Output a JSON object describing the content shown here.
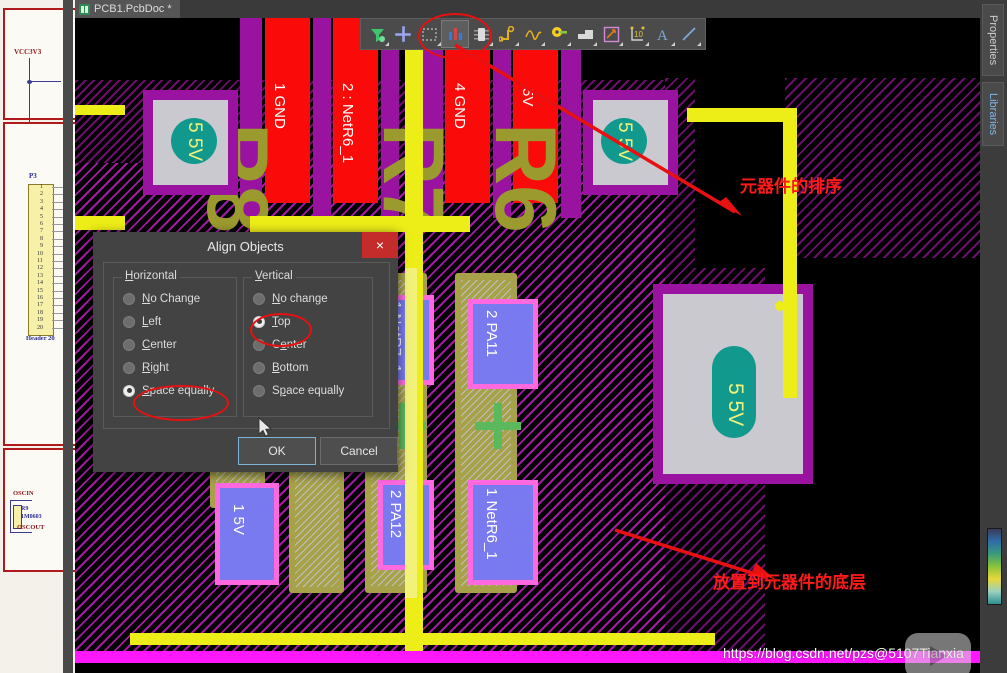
{
  "app": {
    "document_tab": "PCB1.PcbDoc *",
    "tab_icon": "pcb-document-icon"
  },
  "toolbar": {
    "name": "wiring-toolbar",
    "buttons": [
      {
        "icon": "net-filter-icon",
        "label": "Net Filter"
      },
      {
        "icon": "via-cross-icon",
        "label": "Place Via"
      },
      {
        "icon": "fill-region-icon",
        "label": "Place Fill"
      },
      {
        "icon": "component-bars-icon",
        "label": "Place Component",
        "selected": true
      },
      {
        "icon": "ic-chip-icon",
        "label": "Place Device"
      },
      {
        "icon": "route-track-icon",
        "label": "Interactive Routing"
      },
      {
        "icon": "differential-pair-icon",
        "label": "Differential Pair Routing"
      },
      {
        "icon": "pad-icon",
        "label": "Place Pad"
      },
      {
        "icon": "polygon-pour-icon",
        "label": "Place Polygon Pour"
      },
      {
        "icon": "dimension-icon",
        "label": "Place Dimension"
      },
      {
        "icon": "coordinate-icon",
        "label": "Place Coordinate"
      },
      {
        "icon": "text-string-icon",
        "label": "Place String"
      },
      {
        "icon": "line-icon",
        "label": "Place Line"
      }
    ]
  },
  "dialog": {
    "title": "Align Objects",
    "close_label": "×",
    "horizontal": {
      "caption": "Horizontal",
      "caption_accel": "H",
      "options": [
        {
          "label": "No Change",
          "accel": "N",
          "selected": false
        },
        {
          "label": "Left",
          "accel": "L",
          "selected": false
        },
        {
          "label": "Center",
          "accel": "C",
          "selected": false
        },
        {
          "label": "Right",
          "accel": "R",
          "selected": false
        },
        {
          "label": "Space equally",
          "accel": "S",
          "selected": true
        }
      ]
    },
    "vertical": {
      "caption": "Vertical",
      "caption_accel": "V",
      "options": [
        {
          "label": "No change",
          "accel": "N",
          "selected": false
        },
        {
          "label": "Top",
          "accel": "T",
          "selected": true
        },
        {
          "label": "Center",
          "accel": "e",
          "selected": false
        },
        {
          "label": "Bottom",
          "accel": "B",
          "selected": false
        },
        {
          "label": "Space equally",
          "accel": "p",
          "selected": false
        }
      ]
    },
    "ok_label": "OK",
    "cancel_label": "Cancel"
  },
  "annotations": [
    {
      "text": "元器件的排序",
      "color": "#ff1a1a"
    },
    {
      "text": "放置到元器件的底层",
      "color": "#ff1a1a"
    }
  ],
  "right_dock": {
    "tabs": [
      {
        "label": "Properties",
        "accent": "#cfcfcf"
      },
      {
        "label": "Libraries",
        "accent": "#7fb8e8"
      }
    ]
  },
  "schematic": {
    "labels": [
      {
        "text": "VCC3V3",
        "color": "#8b1a1a"
      },
      {
        "text": "P3",
        "color": "#2b2b8f"
      },
      {
        "text": "Header 20",
        "color": "#2b2b8f"
      },
      {
        "text": "OSCIN",
        "color": "#8b1a1a"
      },
      {
        "text": "R9",
        "color": "#2b2b8f"
      },
      {
        "text": "1M0603",
        "color": "#2b2b8f"
      },
      {
        "text": "OSCOUT",
        "color": "#8b1a1a"
      }
    ],
    "header_pins": [
      "1",
      "2",
      "3",
      "4",
      "5",
      "6",
      "7",
      "8",
      "9",
      "10",
      "11",
      "12",
      "13",
      "14",
      "15",
      "16",
      "17",
      "18",
      "19",
      "20"
    ]
  },
  "pcb": {
    "pad_labels": [
      {
        "text": "1  GND",
        "color": "#ffffff"
      },
      {
        "text": "2 : NetR6_1",
        "color": "#ffffff"
      },
      {
        "text": "4  GND",
        "color": "#ffffff"
      },
      {
        "text": "5V",
        "color": "#ffffff"
      },
      {
        "text": "1 NetR7_1",
        "color": "#ffffff"
      },
      {
        "text": "2 PA11",
        "color": "#ffffff"
      },
      {
        "text": "2 PA12",
        "color": "#ffffff"
      },
      {
        "text": "1 NetR6_1",
        "color": "#ffffff"
      },
      {
        "text": "1 5V",
        "color": "#ffffff"
      },
      {
        "text": "5 5V",
        "color": "#f2f27a"
      },
      {
        "text": "5 5V",
        "color": "#f2f27a"
      },
      {
        "text": "5 5V",
        "color": "#f2f27a"
      }
    ],
    "silkscreen": [
      "R8",
      "R7",
      "R6"
    ]
  },
  "footer": {
    "url": "https://blog.csdn.net/pzs@5107Tianxia",
    "watermark_icon": "play-button-watermark"
  }
}
